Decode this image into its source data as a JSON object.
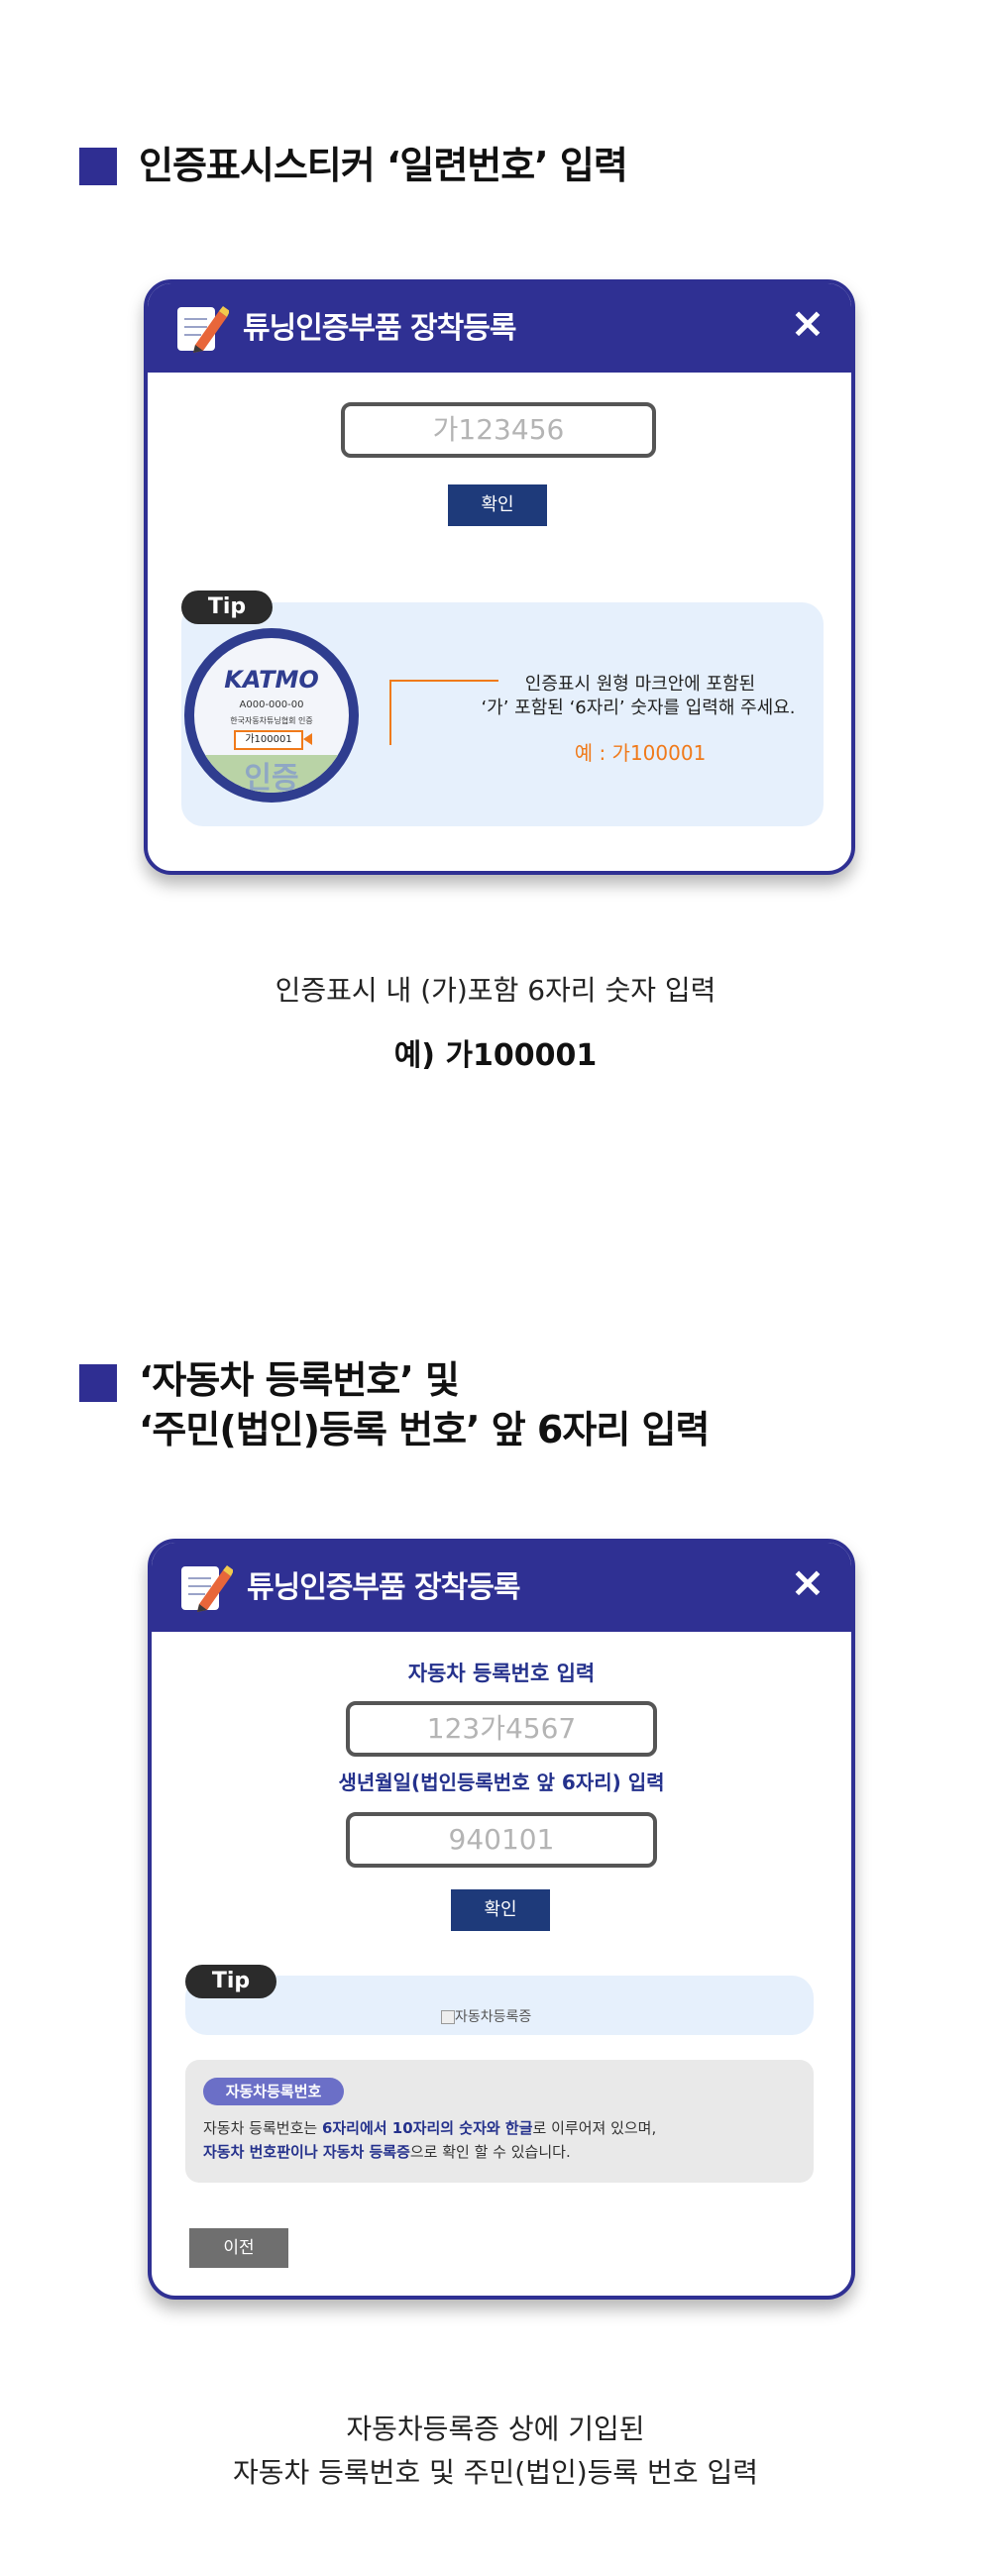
{
  "section1": {
    "title": "인증표시스티커 ‘일련번호’ 입력",
    "modal": {
      "title": "튜닝인증부품 장착등록",
      "close": "×",
      "input_placeholder": "가123456",
      "confirm_label": "확인",
      "tip_label": "Tip",
      "seal": {
        "brand": "KATMO",
        "code": "A000-000-00",
        "org_text": "한국자동차튜닝협회 인증",
        "serial": "가100001",
        "stamp": "인증"
      },
      "tip_line1": "인증표시 원형 마크안에 포함된",
      "tip_line2": "‘가’ 포함된 ‘6자리’ 숫자를 입력해 주세요.",
      "tip_example": "예 : 가100001"
    },
    "caption": "인증표시 내 (가)포함 6자리 숫자 입력",
    "example": "예) 가100001"
  },
  "section2": {
    "title_line1": "‘자동차 등록번호’ 및",
    "title_line2": "‘주민(법인)등록 번호’ 앞 6자리 입력",
    "modal": {
      "title": "튜닝인증부품 장착등록",
      "close": "×",
      "car_number_label": "자동차 등록번호 입력",
      "car_number_placeholder": "123가4567",
      "birth_label": "생년월일(법인등록번호 앞 6자리) 입력",
      "birth_placeholder": "940101",
      "confirm_label": "확인",
      "tip_label": "Tip",
      "broken_image_alt": "자동차등록증",
      "info_badge": "자동차등록번호",
      "info_line1_a": "자동차 등록번호는 ",
      "info_line1_b": "6자리에서 10자리의 숫자와 한글",
      "info_line1_c": "로 이루어져 있으며,",
      "info_line2_a": "자동차 번호판이나 자동차 등록증",
      "info_line2_b": "으로 확인 할 수 있습니다.",
      "prev_label": "이전"
    },
    "caption_line1": "자동차등록증 상에 기입된",
    "caption_line2": "자동차 등록번호 및 주민(법인)등록 번호 입력"
  },
  "colors": {
    "brand_navy": "#2f3093",
    "button_navy": "#1e3a7a",
    "tip_bg": "#e6f0fc",
    "accent_orange": "#f07a1a",
    "info_badge": "#6b6fc7",
    "highlight_text": "#24318c"
  }
}
